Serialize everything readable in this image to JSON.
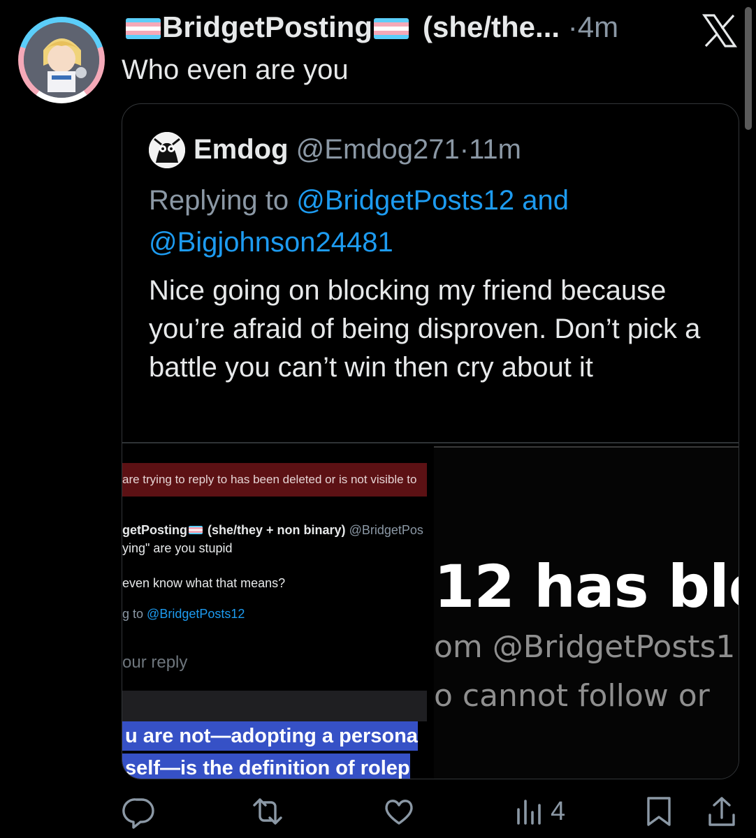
{
  "post": {
    "display_name": "BridgetPosting",
    "handle_truncated": "(she/the...",
    "separator": "·",
    "time": "4m",
    "text": "Who even are you"
  },
  "quoted": {
    "display_name": "Emdog",
    "handle": "@Emdog271",
    "separator": "·",
    "time": "11m",
    "replying_prefix": "Replying to",
    "replying_user1": "@BridgetPosts12",
    "replying_and": "and",
    "replying_user2": "@Bigjohnson24481",
    "body": "Nice going on blocking my friend because you’re afraid of being disproven. Don’t pick a battle you can’t win then cry about it"
  },
  "screenshot_left": {
    "error_text": "are trying to reply to has been deleted or is not visible to",
    "name": "getPosting",
    "pronouns": "(she/they + non binary)",
    "handle": "@BridgetPos",
    "line1": "ying\" are you stupid",
    "line2": "even know what that means?",
    "reply_prefix": "g to",
    "reply_user": "@BridgetPosts12",
    "placeholder": "our reply",
    "sel1": "u are not—adopting a persona",
    "sel2": "self—is the definition of rolep"
  },
  "screenshot_right": {
    "big": "12 has bloc",
    "mid1": "om @BridgetPosts1",
    "mid2": "o cannot follow or"
  },
  "actions": {
    "views_count": "4"
  },
  "icons": {
    "close": "x-logo-icon",
    "reply": "reply-icon",
    "repost": "repost-icon",
    "like": "like-icon",
    "views": "views-icon",
    "bookmark": "bookmark-icon",
    "share": "share-icon"
  },
  "colors": {
    "background": "#000000",
    "text": "#e7e9ea",
    "secondary": "#8b98a5",
    "link": "#1d9bf0",
    "trans_blue": "#5bcefa",
    "trans_pink": "#f5a9b8"
  }
}
